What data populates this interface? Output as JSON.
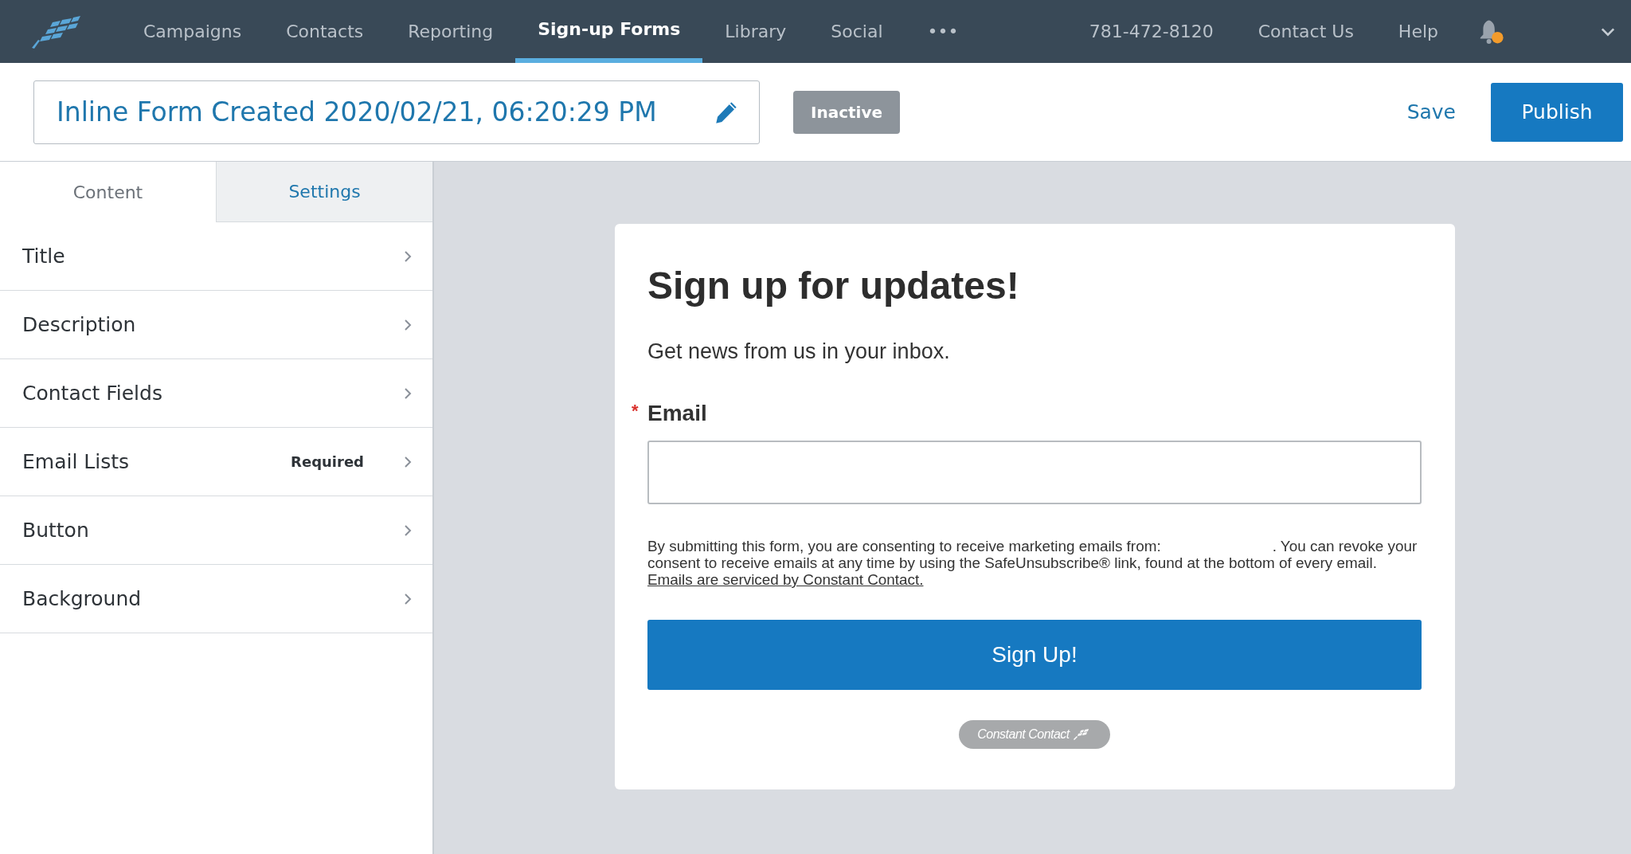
{
  "nav": {
    "items": [
      {
        "label": "Campaigns",
        "selected": false
      },
      {
        "label": "Contacts",
        "selected": false
      },
      {
        "label": "Reporting",
        "selected": false
      },
      {
        "label": "Sign-up Forms",
        "selected": true
      },
      {
        "label": "Library",
        "selected": false
      },
      {
        "label": "Social",
        "selected": false
      },
      {
        "label": "•••",
        "selected": false
      }
    ],
    "right": [
      "781-472-8120",
      "Contact Us",
      "Help"
    ],
    "notification": true
  },
  "header": {
    "form_name": "Inline Form Created 2020/02/21, 06:20:29 PM",
    "status": "Inactive",
    "save": "Save",
    "publish": "Publish"
  },
  "sidebar": {
    "tabs": [
      {
        "label": "Content",
        "selected": true
      },
      {
        "label": "Settings",
        "selected": false
      }
    ],
    "items": [
      {
        "label": "Title"
      },
      {
        "label": "Description"
      },
      {
        "label": "Contact Fields"
      },
      {
        "label": "Email Lists",
        "badge": "Required"
      },
      {
        "label": "Button"
      },
      {
        "label": "Background"
      }
    ]
  },
  "form": {
    "title": "Sign up for updates!",
    "description": "Get news from us in your inbox.",
    "field": {
      "label": "Email",
      "required": true,
      "required_mark": "*"
    },
    "consent": {
      "before": "By submitting this form, you are consenting to receive marketing emails from:",
      "after": ". You can revoke your consent to receive emails at any time by using the SafeUnsubscribe® link, found at the bottom of every email.",
      "link": "Emails are serviced by Constant Contact."
    },
    "button": "Sign Up!",
    "brand": "Constant Contact"
  }
}
